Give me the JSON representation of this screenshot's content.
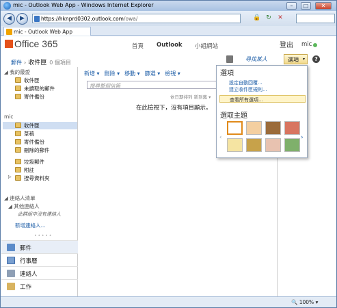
{
  "window": {
    "title": "mic - Outlook Web App - Windows Internet Explorer",
    "controls": {
      "minimize": "–",
      "maximize": "□",
      "close": "✕"
    }
  },
  "address": {
    "url_host": "https://hknprd0302.outlook.com",
    "url_path": "/owa/"
  },
  "tab": {
    "label": "mic - Outlook Web App"
  },
  "header": {
    "logo": "Office 365",
    "nav": [
      "首頁",
      "Outlook",
      "小組網站"
    ],
    "signout": "登出",
    "user": "mic"
  },
  "breadcrumb": {
    "mail": "郵件",
    "sep": "›",
    "folder": "收件匣",
    "count": "0 個項目"
  },
  "find_people": "尋找某人",
  "options_button": "選項",
  "help": "?",
  "favorites": {
    "header": "我的最愛",
    "items": [
      "收件匣",
      "未讀取的郵件",
      "寄件備份"
    ]
  },
  "mailbox": {
    "header": "mic",
    "items": [
      "收件匣",
      "草稿",
      "寄件備份",
      "刪除的郵件",
      "垃圾郵件",
      "附註",
      "搜尋資料夾"
    ]
  },
  "contacts": {
    "header": "連絡人清單",
    "group": "其他連絡人",
    "empty": "此群組中沒有連絡人",
    "new_link": "新增連絡人..."
  },
  "modules": [
    "郵件",
    "行事曆",
    "連絡人",
    "工作"
  ],
  "toolbar": {
    "items": [
      "新增 ▾",
      "刪除 ▾",
      "移動 ▾",
      "篩選 ▾",
      "檢視 ▾"
    ]
  },
  "search_placeholder": "搜尋整個信箱",
  "arrange_label": "依日期排列 新到舊 ▾",
  "empty_message": "在此檢視下，沒有項目顯示。",
  "options_menu": {
    "title": "選項",
    "links": [
      "設定自動回覆...",
      "建立收件匣規則...",
      "查看所有選項..."
    ],
    "theme_title": "選取主題"
  },
  "themes": [
    "#ffffff",
    "#f4cfa0",
    "#9b6b3a",
    "#d87560",
    "#f5e4a2",
    "#c7a24a",
    "#e8c2b0",
    "#7fb06b"
  ],
  "status": {
    "zoom": "100%"
  }
}
